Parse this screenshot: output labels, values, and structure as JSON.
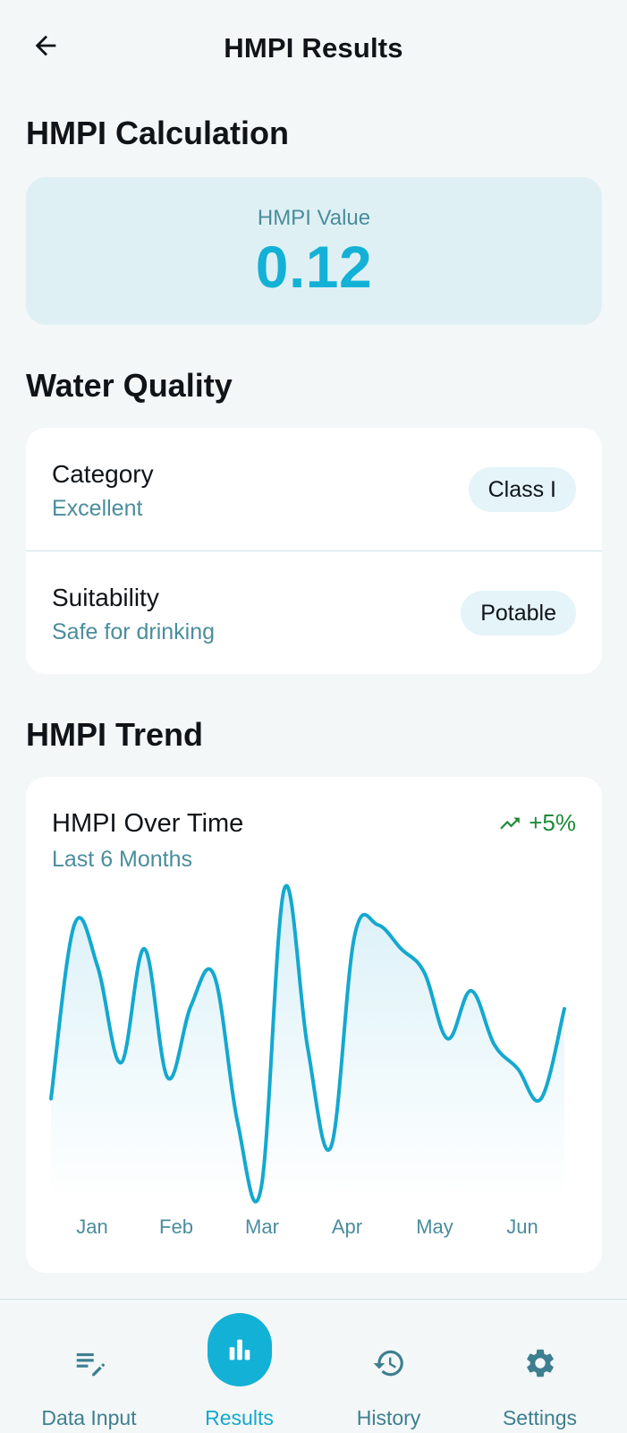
{
  "header": {
    "title": "HMPI Results"
  },
  "calculation": {
    "section_title": "HMPI Calculation",
    "label": "HMPI Value",
    "value": "0.12"
  },
  "quality": {
    "section_title": "Water Quality",
    "rows": [
      {
        "title": "Category",
        "subtitle": "Excellent",
        "badge": "Class I"
      },
      {
        "title": "Suitability",
        "subtitle": "Safe for drinking",
        "badge": "Potable"
      }
    ]
  },
  "trend": {
    "section_title": "HMPI Trend",
    "card_title": "HMPI Over Time",
    "card_subtitle": "Last 6 Months",
    "change": "+5%",
    "change_icon": "trending-up-icon"
  },
  "chart_data": {
    "type": "area",
    "categories": [
      "Jan",
      "Feb",
      "Mar",
      "Apr",
      "May",
      "Jun"
    ],
    "x": [
      0,
      0.25,
      0.5,
      0.75,
      1,
      1.25,
      1.5,
      1.75,
      2,
      2.25,
      2.5,
      2.75,
      3,
      3.25,
      3.5,
      3.75,
      4,
      4.25,
      4.5,
      4.75,
      5,
      5.25,
      5.5
    ],
    "values": [
      0.3,
      0.88,
      0.74,
      0.42,
      0.8,
      0.37,
      0.61,
      0.71,
      0.22,
      0.0,
      1.0,
      0.47,
      0.14,
      0.84,
      0.88,
      0.8,
      0.72,
      0.5,
      0.66,
      0.48,
      0.4,
      0.3,
      0.6
    ],
    "series_color": "#14a8cf",
    "fill_color": "#e2f4f9",
    "grid": false,
    "note_units": "relative"
  },
  "nav": {
    "items": [
      {
        "label": "Data Input",
        "icon": "edit-list-icon",
        "active": false
      },
      {
        "label": "Results",
        "icon": "bar-chart-icon",
        "active": true
      },
      {
        "label": "History",
        "icon": "history-icon",
        "active": false
      },
      {
        "label": "Settings",
        "icon": "gear-icon",
        "active": false
      }
    ]
  },
  "colors": {
    "accent": "#14b1d6",
    "muted_text": "#4a8d9d",
    "positive": "#1e8a3a",
    "background": "#f4f7f7"
  }
}
